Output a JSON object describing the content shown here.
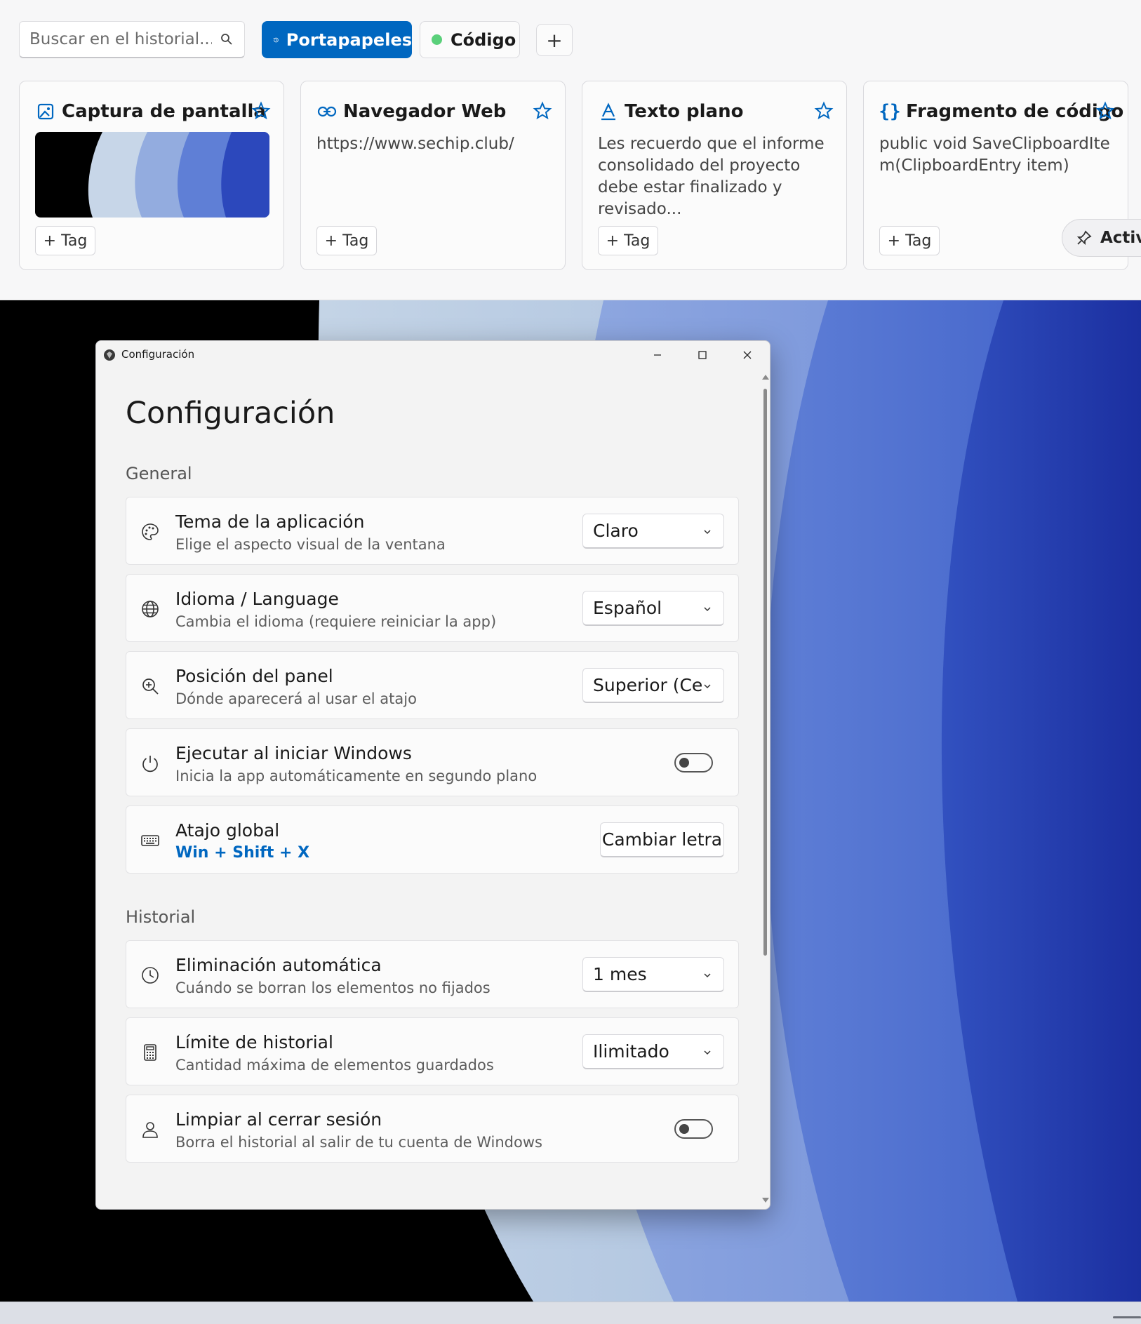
{
  "clipboard_panel": {
    "search": {
      "placeholder": "Buscar en el historial..."
    },
    "tabs": [
      {
        "label": "Portapapeles",
        "icon": "history-icon",
        "active": true
      },
      {
        "label": "Código",
        "icon": "green-dot",
        "active": false
      }
    ],
    "add_tab_label": "+",
    "cards": [
      {
        "type": "image",
        "icon": "image-icon",
        "title": "Captura de pantalla",
        "content": "",
        "tag_label": "+ Tag",
        "starred": false
      },
      {
        "type": "link",
        "icon": "link-icon",
        "title": "Navegador Web",
        "content": "https://www.sechip.club/",
        "tag_label": "+ Tag",
        "starred": false
      },
      {
        "type": "text",
        "icon": "text-icon",
        "title": "Texto plano",
        "content": "Les recuerdo que el informe consolidado del proyecto debe estar finalizado y revisado...",
        "tag_label": "+ Tag",
        "starred": false
      },
      {
        "type": "code",
        "icon": "braces-icon",
        "title": "Fragmento de código",
        "content": "public void SaveClipboardItem(ClipboardEntry item)",
        "tag_label": "+ Tag",
        "starred": false
      }
    ],
    "pin_label": "Activa"
  },
  "settings": {
    "window_title": "Configuración",
    "page_title": "Configuración",
    "sections": [
      {
        "label": "General",
        "items": [
          {
            "icon": "palette-icon",
            "title": "Tema de la aplicación",
            "description": "Elige el aspecto visual de la ventana",
            "control": "dropdown",
            "value": "Claro"
          },
          {
            "icon": "globe-icon",
            "title": "Idioma / Language",
            "description": "Cambia el idioma (requiere reiniciar la app)",
            "control": "dropdown",
            "value": "Español"
          },
          {
            "icon": "zoom-icon",
            "title": "Posición del panel",
            "description": "Dónde aparecerá al usar el atajo",
            "control": "dropdown",
            "value": "Superior (Ce"
          },
          {
            "icon": "power-icon",
            "title": "Ejecutar al iniciar Windows",
            "description": "Inicia la app automáticamente en segundo plano",
            "control": "toggle",
            "value": "off"
          },
          {
            "icon": "keyboard-icon",
            "title": "Atajo global",
            "hotkey": "Win + Shift + X",
            "control": "button",
            "value": "Cambiar letra"
          }
        ]
      },
      {
        "label": "Historial",
        "items": [
          {
            "icon": "clock-icon",
            "title": "Eliminación automática",
            "description": "Cuándo se borran los elementos no fijados",
            "control": "dropdown",
            "value": "1 mes"
          },
          {
            "icon": "calculator-icon",
            "title": "Límite de historial",
            "description": "Cantidad máxima de elementos guardados",
            "control": "dropdown",
            "value": "Ilimitado"
          },
          {
            "icon": "user-icon",
            "title": "Limpiar al cerrar sesión",
            "description": "Borra el historial al salir de tu cuenta de Windows",
            "control": "toggle",
            "value": "off"
          }
        ]
      }
    ]
  },
  "colors": {
    "accent": "#0067c0",
    "panel_bg": "#f7f7f8",
    "window_bg": "#f3f3f3",
    "code_dot": "#5ad07a"
  }
}
